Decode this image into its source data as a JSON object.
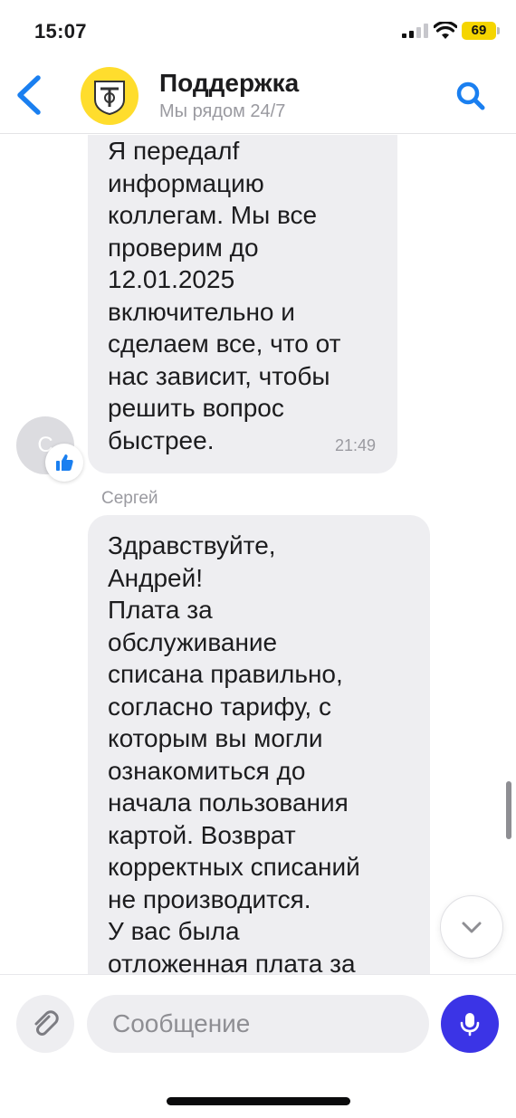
{
  "status_bar": {
    "time": "15:07",
    "battery": "69"
  },
  "header": {
    "title": "Поддержка",
    "subtitle": "Мы рядом 24/7"
  },
  "messages": [
    {
      "text": "Я передалf\nинформацию\nколлегам. Мы все\nпроверим до\n12.01.2025\nвключительно и\nсделаем все, что от\nнас зависит, чтобы\nрешить вопрос\nбыстрее.",
      "time": "21:49",
      "avatar_letter": "С"
    },
    {
      "sender": "Сергей",
      "text": "Здравствуйте,\nАндрей!\nПлата за\nобслуживание\nсписана правильно,\nсогласно тарифу, с\nкоторым вы могли\nознакомиться до\nначала пользования\nкартой. Возврат\nкорректных списаний\nне производится.\nУ вас была\nотложенная плата за"
    }
  ],
  "composer": {
    "placeholder": "Сообщение"
  },
  "colors": {
    "accent": "#1a7ff0",
    "brand_yellow": "#ffdd2d",
    "mic": "#3b34e6",
    "bubble": "#eeeef1"
  }
}
